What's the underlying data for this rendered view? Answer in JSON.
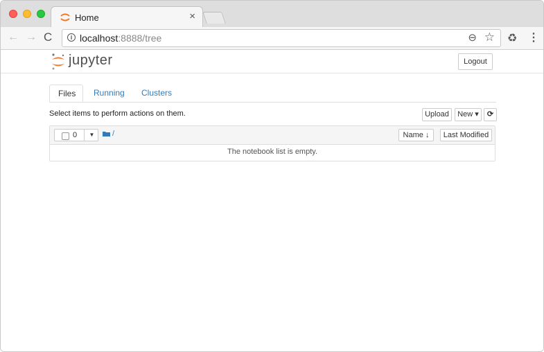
{
  "browser": {
    "tab": {
      "title": "Home",
      "close_glyph": "×",
      "favicon": "jupyter-favicon"
    },
    "nav": {
      "back_glyph": "←",
      "forward_glyph": "→",
      "reload_glyph": "C"
    },
    "address": {
      "host": "localhost",
      "rest": ":8888/tree"
    },
    "icons": {
      "info": "i",
      "zoom": "⊖",
      "star": "☆",
      "extension": "♻",
      "menu": "⋮"
    }
  },
  "page": {
    "logo_text": "jupyter",
    "logout_label": "Logout",
    "tabs": [
      {
        "label": "Files",
        "active": true
      },
      {
        "label": "Running",
        "active": false
      },
      {
        "label": "Clusters",
        "active": false
      }
    ],
    "hint": "Select items to perform actions on them.",
    "buttons": {
      "upload": "Upload",
      "new": "New ▾",
      "refresh": "⟳"
    },
    "list": {
      "selected_count": "0",
      "dropdown_glyph": "▼",
      "breadcrumb": "/",
      "sort_name": "Name ↓",
      "sort_modified": "Last Modified",
      "empty_message": "The notebook list is empty."
    }
  },
  "colors": {
    "link": "#337ab7",
    "jupyter_orange": "#f37726",
    "tab_strip": "#dedede"
  }
}
